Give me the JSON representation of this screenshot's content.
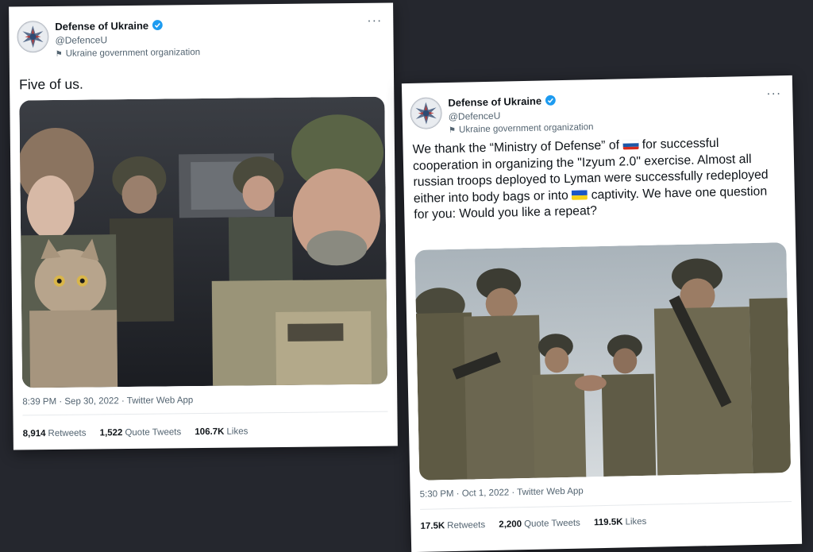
{
  "tweet1": {
    "author_name": "Defense of Ukraine",
    "handle": "@DefenceU",
    "org_label": "Ukraine government organization",
    "text": "Five of us.",
    "timestamp": "8:39 PM · Sep 30, 2022 · Twitter Web App",
    "retweets": "8,914",
    "retweets_label": "Retweets",
    "quote_tweets": "1,522",
    "quote_tweets_label": "Quote Tweets",
    "likes": "106.7K",
    "likes_label": "Likes",
    "image_caption": "Five people seated in a vehicle, one holding a tabby cat"
  },
  "tweet2": {
    "author_name": "Defense of Ukraine",
    "handle": "@DefenceU",
    "org_label": "Ukraine government organization",
    "text_part1": "We thank the “Ministry of Defense” of",
    "text_part2": "for successful cooperation in organizing the \"Izyum 2.0\" exercise. Almost all russian troops deployed to Lyman were successfully redeployed either into body bags or into",
    "text_part3": "captivity. We have one question for you: Would you like a repeat?",
    "timestamp": "5:30 PM · Oct 1, 2022 · Twitter Web App",
    "retweets": "17.5K",
    "retweets_label": "Retweets",
    "quote_tweets": "2,200",
    "quote_tweets_label": "Quote Tweets",
    "likes": "119.5K",
    "likes_label": "Likes",
    "image_caption": "Soldiers in camouflage joining hands in a circle under a cloudy sky"
  },
  "colors": {
    "background": "#25272e",
    "verified_blue": "#1d9bf0",
    "secondary_text": "#536471",
    "primary_text": "#0f1419"
  }
}
